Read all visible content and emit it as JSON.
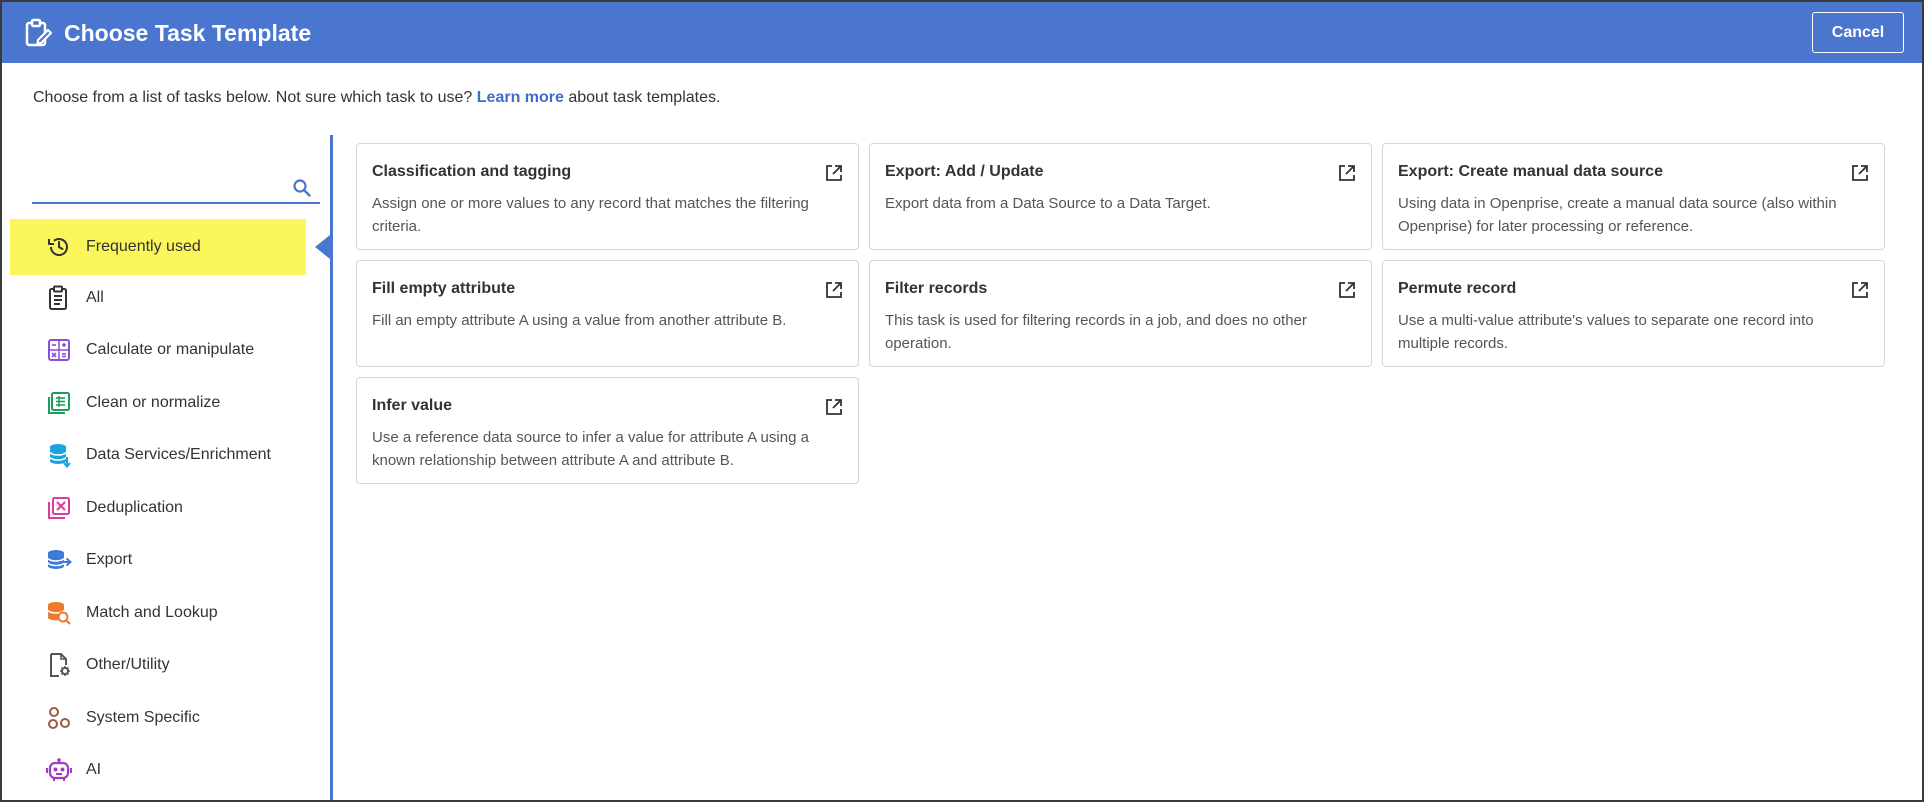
{
  "header": {
    "title": "Choose Task Template",
    "cancel_label": "Cancel",
    "icon": "clipboard-edit-icon"
  },
  "intro": {
    "text_before": "Choose from a list of tasks below. Not sure which task to use?",
    "link_text": "Learn more",
    "text_after": "about task templates."
  },
  "search": {
    "placeholder": "",
    "value": ""
  },
  "sidebar": {
    "items": [
      {
        "label": "Frequently used",
        "icon": "history-icon",
        "active": true
      },
      {
        "label": "All",
        "icon": "clipboard-list-icon"
      },
      {
        "label": "Calculate or manipulate",
        "icon": "calculator-icon"
      },
      {
        "label": "Clean or normalize",
        "icon": "spreadsheet-icon"
      },
      {
        "label": "Data Services/Enrichment",
        "icon": "database-download-icon"
      },
      {
        "label": "Deduplication",
        "icon": "duplicate-remove-icon"
      },
      {
        "label": "Export",
        "icon": "database-export-icon"
      },
      {
        "label": "Match and Lookup",
        "icon": "database-search-icon"
      },
      {
        "label": "Other/Utility",
        "icon": "file-gear-icon"
      },
      {
        "label": "System Specific",
        "icon": "nodes-icon"
      },
      {
        "label": "AI",
        "icon": "robot-icon"
      }
    ]
  },
  "cards": [
    {
      "title": "Classification and tagging",
      "description": "Assign one or more values to any record that matches the filtering criteria."
    },
    {
      "title": "Export: Add / Update",
      "description": "Export data from a Data Source to a Data Target."
    },
    {
      "title": "Export: Create manual data source",
      "description": "Using data in Openprise, create a manual data source (also within Openprise) for later processing or reference."
    },
    {
      "title": "Fill empty attribute",
      "description": "Fill an empty attribute A using a value from another attribute B."
    },
    {
      "title": "Filter records",
      "description": "This task is used for filtering records in a job, and does no other operation."
    },
    {
      "title": "Permute record",
      "description": "Use a multi-value attribute's values to separate one record into multiple records."
    },
    {
      "title": "Infer value",
      "description": "Use a reference data source to infer a value for attribute A using a known relationship between attribute A and attribute B."
    }
  ],
  "colors": {
    "header_bg": "#4a76d0",
    "highlight": "#fbf65a",
    "link": "#3b6fc9"
  }
}
